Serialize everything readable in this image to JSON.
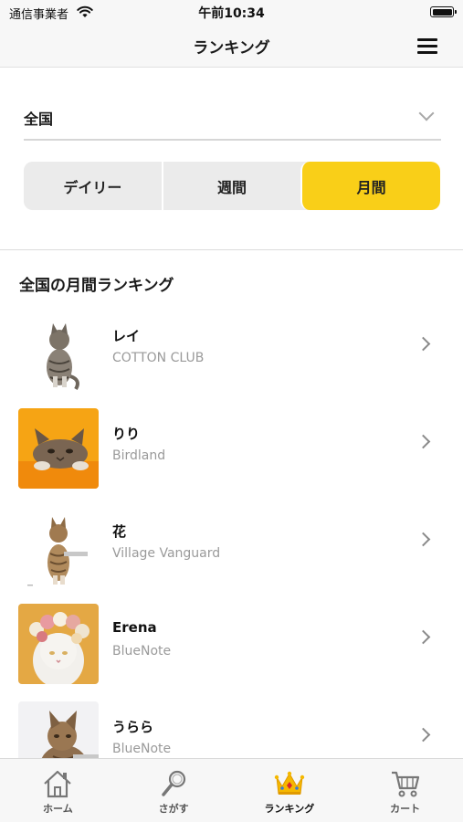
{
  "status_bar": {
    "carrier": "通信事業者",
    "time": "午前10:34"
  },
  "nav": {
    "title": "ランキング",
    "menu_icon": "hamburger-menu-icon"
  },
  "region": {
    "selected": "全国"
  },
  "period_tabs": {
    "items": [
      {
        "label": "デイリー",
        "active": false
      },
      {
        "label": "週間",
        "active": false
      },
      {
        "label": "月間",
        "active": true
      }
    ],
    "active_color": "#f9cf18"
  },
  "section": {
    "title": "全国の月間ランキング"
  },
  "ranking": {
    "items": [
      {
        "name": "レイ",
        "venue": "COTTON CLUB",
        "image": "tabby-cat-sitting"
      },
      {
        "name": "りり",
        "venue": "Birdland",
        "image": "cat-on-orange-background"
      },
      {
        "name": "花",
        "venue": "Village Vanguard",
        "image": "tabby-cat-standing"
      },
      {
        "name": "Erena",
        "venue": "BlueNote",
        "image": "white-cat-flower-crown"
      },
      {
        "name": "うらら",
        "venue": "BlueNote",
        "image": "tabby-cat-profile"
      }
    ]
  },
  "tab_bar": {
    "tabs": [
      {
        "label": "ホーム",
        "icon": "home-icon",
        "active": false
      },
      {
        "label": "さがす",
        "icon": "search-icon",
        "active": false
      },
      {
        "label": "ランキング",
        "icon": "crown-icon",
        "active": true
      },
      {
        "label": "カート",
        "icon": "cart-icon",
        "active": false
      }
    ]
  }
}
